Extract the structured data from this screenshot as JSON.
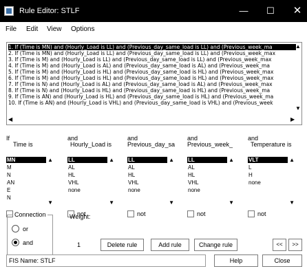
{
  "window": {
    "title": "Rule Editor: STLF",
    "minimize": "—",
    "maximize": "☐",
    "close": "✕"
  },
  "menu": [
    "File",
    "Edit",
    "View",
    "Options"
  ],
  "rules": [
    "1. If (Time is MN) and (Hourly_Load is LL) and (Previous_day_same_load is LL) and (Previous_week_ma",
    "2. If (Time is MN) and (Hourly_Load is LL) and (Previous_day_same_load is LL) and (Previous_week_max",
    "3. If (Time is M) and (Hourly_Load is LL) and (Previous_day_same_load is LL) and (Previous_week_max",
    "4. If (Time is M) and (Hourly_Load is AL) and (Previous_day_same_load is AL) and (Previous_week_ma",
    "5. If (Time is M) and (Hourly_Load is HL) and (Previous_day_same_load is HL) and (Previous_week_max",
    "6. If (Time is M) and (Hourly_Load is HL) and (Previous_day_same_load is HL) and (Previous_week_max",
    "7. If (Time is N) and (Hourly_Load is AL) and (Previous_day_same_load is AL) and (Previous_week_max",
    "8. If (Time is N) and (Hourly_Load is HL) and (Previous_day_same_load is HL) and (Previous_week_ma",
    "9. If (Time is AN) and (Hourly_Load is HL) and (Previous_day_same_load is HL) and (Previous_week_ma",
    "10. If (Time is AN) and (Hourly_Load is VHL) and (Previous_day_same_load is VHL) and (Previous_week"
  ],
  "antecedents": [
    {
      "prefix": "If",
      "name": "Time is",
      "options": [
        "MN",
        "M",
        "N",
        "AN",
        "E",
        "N"
      ],
      "selected": 0,
      "not_label": "not"
    },
    {
      "prefix": "and",
      "name": "Hourly_Load is",
      "options": [
        "LL",
        "AL",
        "HL",
        "VHL",
        "none"
      ],
      "selected": 0,
      "not_label": "not"
    },
    {
      "prefix": "and",
      "name": "Previous_day_sa",
      "options": [
        "LL",
        "AL",
        "HL",
        "VHL",
        "none"
      ],
      "selected": 0,
      "not_label": "not"
    },
    {
      "prefix": "and",
      "name": "Previous_week_",
      "options": [
        "LL",
        "AL",
        "HL",
        "VHL",
        "none"
      ],
      "selected": 0,
      "not_label": "not"
    }
  ],
  "consequent": {
    "prefix": "and",
    "name": "Temperature is",
    "options": [
      "VLT",
      "L",
      "H",
      "none"
    ],
    "selected": 0,
    "not_label": "not"
  },
  "connection": {
    "label": "Connection",
    "options": [
      "or",
      "and"
    ],
    "selected": "and"
  },
  "weight": {
    "label": "Weight:",
    "value": "1"
  },
  "buttons": {
    "delete_rule": "Delete rule",
    "add_rule": "Add rule",
    "change_rule": "Change rule",
    "prev": "<<",
    "next": ">>",
    "help": "Help",
    "close": "Close"
  },
  "status": "FIS Name: STLF"
}
